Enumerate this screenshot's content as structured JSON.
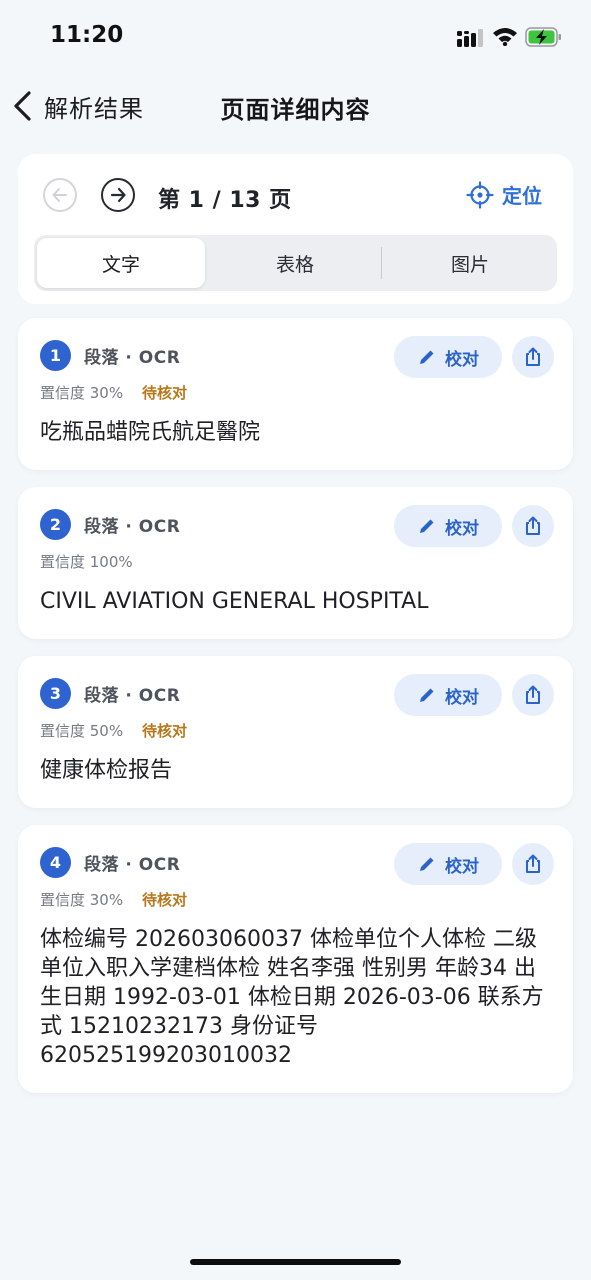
{
  "status_bar": {
    "time": "11:20"
  },
  "nav": {
    "back_label": "解析结果",
    "title": "页面详细内容"
  },
  "pager": {
    "page_indicator": "第 1 / 13 页",
    "locate_label": "定位",
    "tabs": [
      {
        "label": "文字",
        "active": true
      },
      {
        "label": "表格",
        "active": false
      },
      {
        "label": "图片",
        "active": false
      }
    ]
  },
  "blocks": [
    {
      "index": "1",
      "type": "段落 · OCR",
      "confidence": "置信度 30%",
      "status": "待核对",
      "proofread_label": "校对",
      "text": "吃瓶品蜡院氏航足醫院"
    },
    {
      "index": "2",
      "type": "段落 · OCR",
      "confidence": "置信度 100%",
      "status": "",
      "proofread_label": "校对",
      "text": "CIVIL AVIATION GENERAL HOSPITAL"
    },
    {
      "index": "3",
      "type": "段落 · OCR",
      "confidence": "置信度 50%",
      "status": "待核对",
      "proofread_label": "校对",
      "text": "健康体检报告"
    },
    {
      "index": "4",
      "type": "段落 · OCR",
      "confidence": "置信度 30%",
      "status": "待核对",
      "proofread_label": "校对",
      "text": "体检编号 202603060037 体检单位个人体检 二级单位入职入学建档体检 姓名李强 性别男 年龄34 出生日期 1992-03-01 体检日期 2026-03-06 联系方式 15210232173 身份证号 620525199203010032"
    }
  ],
  "colors": {
    "accent": "#2f63d0",
    "pending": "#b9771b",
    "background": "#f4f7fa"
  }
}
